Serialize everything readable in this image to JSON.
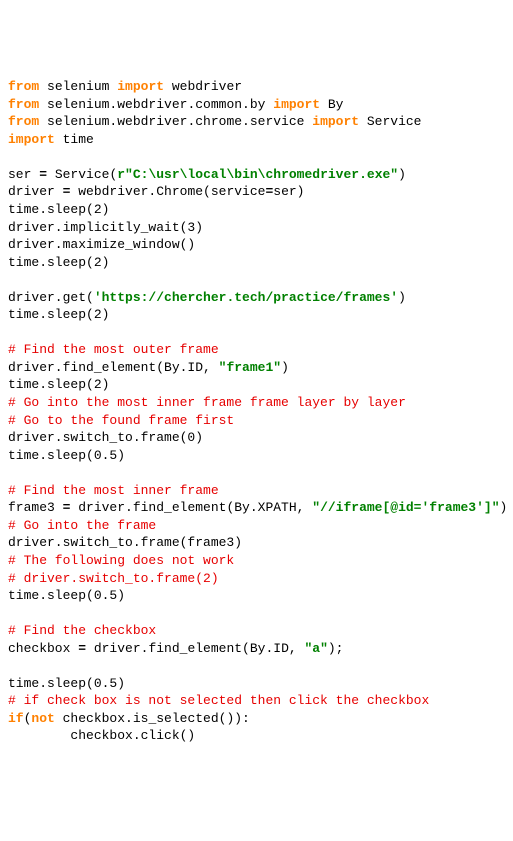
{
  "kw": {
    "from": "from",
    "import": "import",
    "if": "if",
    "not": "not"
  },
  "str": {
    "service_path": "r\"C:\\usr\\local\\bin\\chromedriver.exe\"",
    "url": "'https://chercher.tech/practice/frames'",
    "frame1": "\"frame1\"",
    "xpath": "\"//iframe[@id='frame3']\"",
    "a_id": "\"a\""
  },
  "cmt": {
    "c1": "# Find the most outer frame",
    "c2": "# Go into the most inner frame frame layer by layer",
    "c3": "# Go to the found frame first",
    "c4": "# Find the most inner frame",
    "c5": "# Go into the frame",
    "c6": "# The following does not work",
    "c7": "# driver.switch_to.frame(2)",
    "c8": "# Find the checkbox",
    "c9": "# if check box is not selected then click the checkbox"
  },
  "code": {
    "l1a": " selenium ",
    "l1b": " webdriver",
    "l2a": " selenium.webdriver.common.by ",
    "l2b": " By",
    "l3a": " selenium.webdriver.chrome.service ",
    "l3b": " Service",
    "l4": " time",
    "l6a": "ser ",
    "l6b": " Service(",
    "l6c": ")",
    "l7a": "driver ",
    "l7b": " webdriver.Chrome(service",
    "l7c": "ser)",
    "sleep2": "time.sleep(2)",
    "sleep05": "time.sleep(0.5)",
    "l9": "driver.implicitly_wait(3)",
    "l10": "driver.maximize_window()",
    "l13a": "driver.get(",
    "l13b": ")",
    "l17a": "driver.find_element(By.ID, ",
    "l17b": ")",
    "l21": "driver.switch_to.frame(0)",
    "l25a": "frame3 ",
    "l25b": " driver.find_element(By.XPATH, ",
    "l25c": ")",
    "l27": "driver.switch_to.frame(frame3)",
    "l33a": "checkbox ",
    "l33b": " driver.find_element(By.ID, ",
    "l33c": ");",
    "l37a": "(",
    "l37b": " checkbox.is_selected()):",
    "l38": "        checkbox.click()",
    "eq": "="
  }
}
